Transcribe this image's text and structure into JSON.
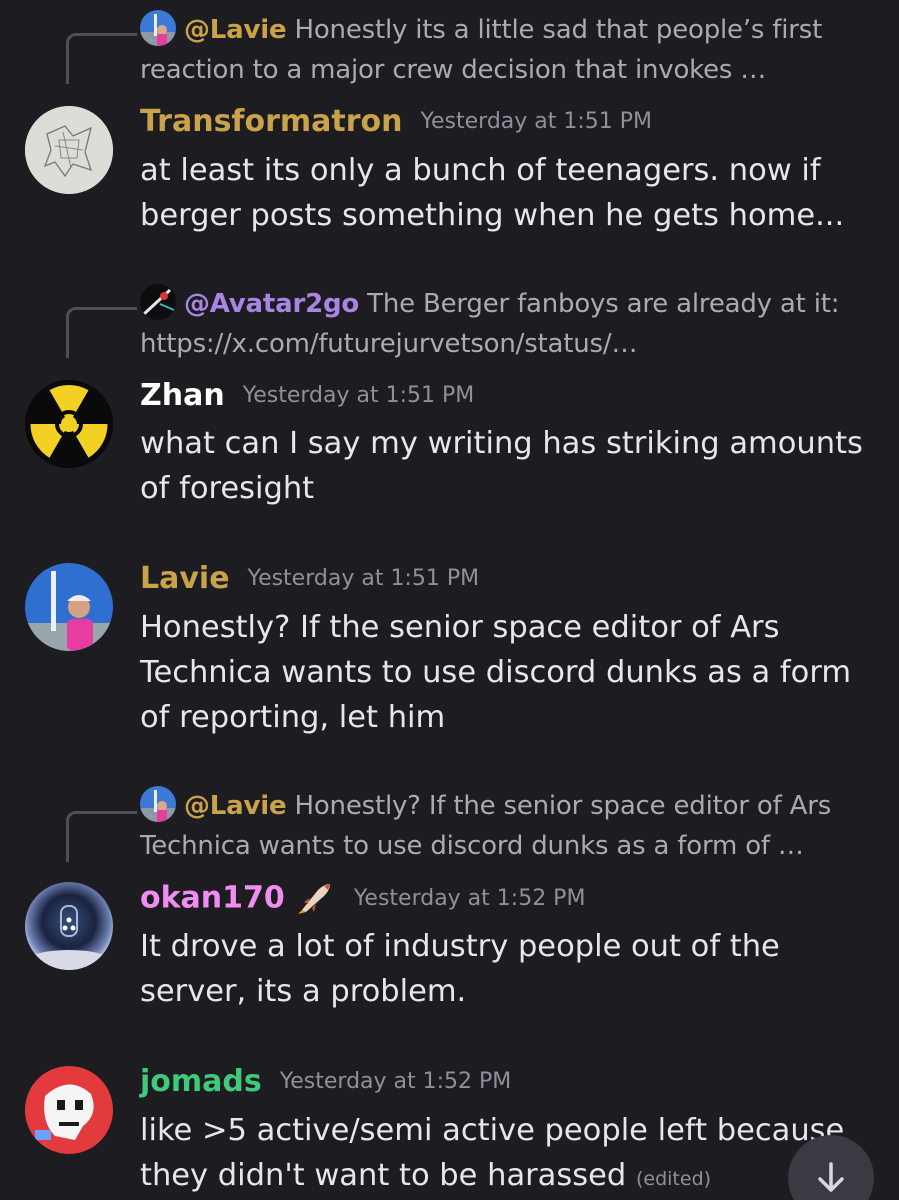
{
  "messages": [
    {
      "reply": {
        "mention": "@Lavie",
        "text": "Honestly its a little sad that people’s first reaction to a major crew decision that invokes …"
      },
      "username": "Transformatron",
      "username_color": "#c9a24a",
      "timestamp": "Yesterday at 1:51 PM",
      "content": "at least its only a bunch of teenagers. now if berger posts something when he gets home..."
    },
    {
      "reply": {
        "mention": "@Avatar2go",
        "text": "The Berger fanboys are already at it: https://x.com/futurejurvetson/status/…"
      },
      "username": "Zhan",
      "username_color": "#ffffff",
      "timestamp": "Yesterday at 1:51 PM",
      "content": "what can I say my writing has striking amounts of foresight"
    },
    {
      "username": "Lavie",
      "username_color": "#c9a24a",
      "timestamp": "Yesterday at 1:51 PM",
      "content": "Honestly? If the senior space editor of Ars Technica wants to use discord dunks as a form of reporting, let him"
    },
    {
      "reply": {
        "mention": "@Lavie",
        "text": "Honestly? If the senior space editor of Ars Technica wants to use discord dunks as a form of …"
      },
      "username": "okan170",
      "username_color": "#f08cf2",
      "badge_icon": "rocket-icon",
      "timestamp": "Yesterday at 1:52 PM",
      "content": "It drove a lot of industry people out of the server, its a problem."
    },
    {
      "username": "jomads",
      "username_color": "#3ec97b",
      "timestamp": "Yesterday at 1:52 PM",
      "content": "like >5 active/semi active people left because they didn't want to be harassed",
      "edited": "(edited)"
    }
  ],
  "scroll_button_icon": "arrow-down-icon"
}
